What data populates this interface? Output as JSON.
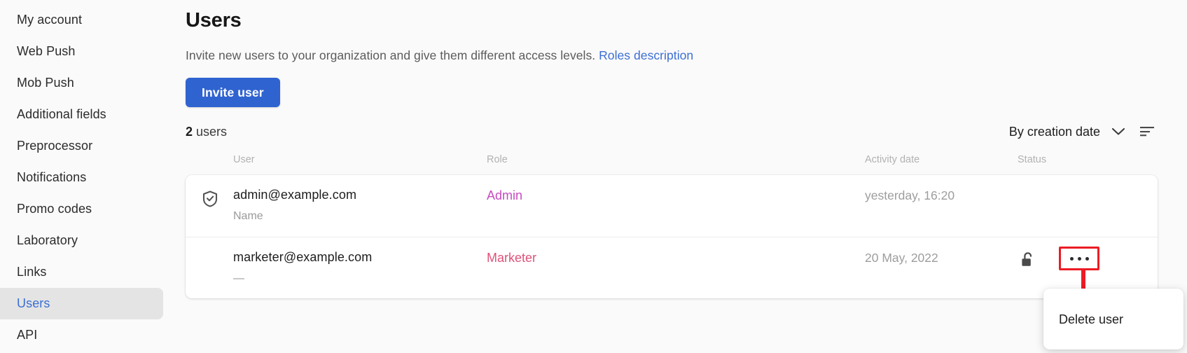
{
  "sidebar": {
    "items": [
      {
        "label": "My account",
        "active": false
      },
      {
        "label": "Web Push",
        "active": false
      },
      {
        "label": "Mob Push",
        "active": false
      },
      {
        "label": "Additional fields",
        "active": false
      },
      {
        "label": "Preprocessor",
        "active": false
      },
      {
        "label": "Notifications",
        "active": false
      },
      {
        "label": "Promo codes",
        "active": false
      },
      {
        "label": "Laboratory",
        "active": false
      },
      {
        "label": "Links",
        "active": false
      },
      {
        "label": "Users",
        "active": true
      },
      {
        "label": "API",
        "active": false
      }
    ]
  },
  "page": {
    "title": "Users",
    "subtitle_text": "Invite new users to your organization and give them different access levels.",
    "subtitle_link": "Roles description",
    "invite_button": "Invite user"
  },
  "toolbar": {
    "count_number": "2",
    "count_unit": "users",
    "sort_label": "By creation date",
    "chevron_icon": "chevron-down-icon",
    "list_icon": "sort-list-icon"
  },
  "table": {
    "headers": {
      "user": "User",
      "role": "Role",
      "activity_date": "Activity date",
      "status": "Status"
    },
    "rows": [
      {
        "icon": "shield-check-icon",
        "email": "admin@example.com",
        "name": "Name",
        "role": "Admin",
        "role_color": "#c64bc0",
        "activity_date": "yesterday, 16:20",
        "status_icon": "",
        "has_menu": false
      },
      {
        "icon": "",
        "email": "marketer@example.com",
        "name": "—",
        "role": "Marketer",
        "role_color": "#e0527a",
        "activity_date": "20 May, 2022",
        "status_icon": "unlocked-padlock-icon",
        "has_menu": true
      }
    ]
  },
  "dropdown": {
    "items": [
      {
        "label": "Delete user"
      }
    ]
  },
  "annotation": {
    "highlight_color": "#ec1c24",
    "arrow": "red-down-arrow"
  },
  "colors": {
    "accent_blue": "#2f63d0",
    "link_blue": "#3b6fd4",
    "page_bg": "#fafafa"
  }
}
